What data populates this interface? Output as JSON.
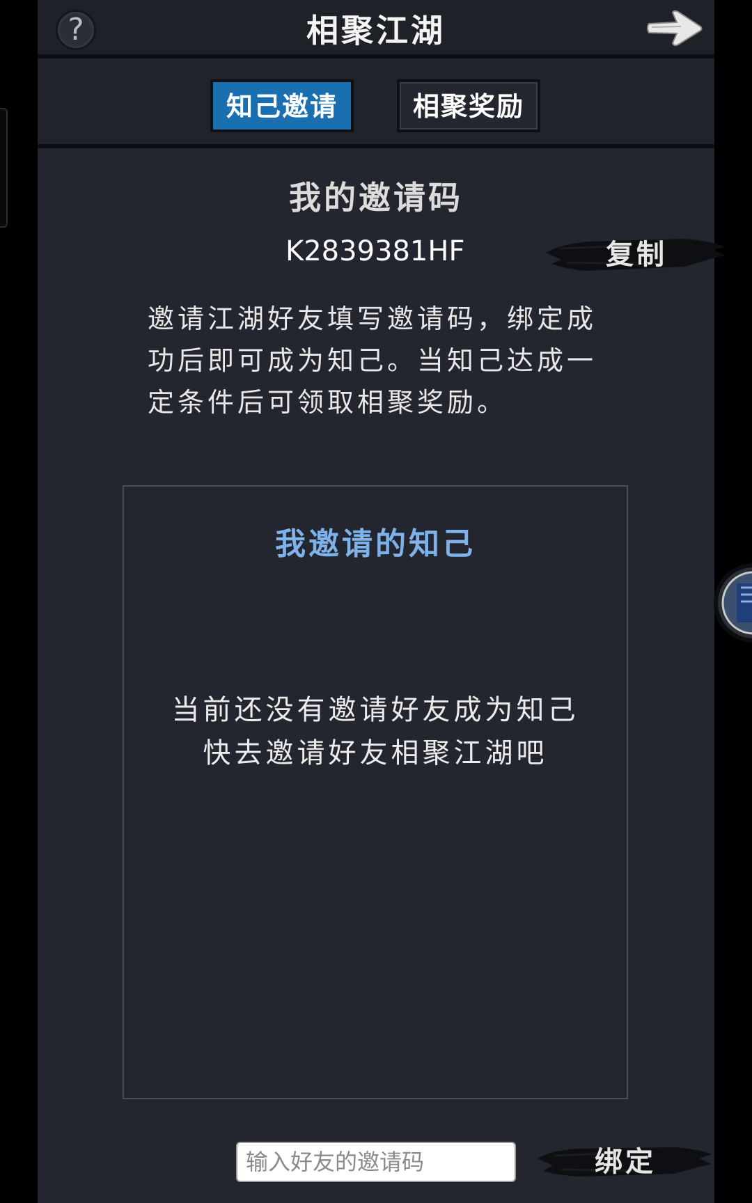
{
  "header": {
    "title": "相聚江湖",
    "help_label": "?"
  },
  "tabs": [
    {
      "label": "知己邀请",
      "active": true
    },
    {
      "label": "相聚奖励",
      "active": false
    }
  ],
  "invite": {
    "heading": "我的邀请码",
    "code": "K2839381HF",
    "copy_label": "复制",
    "description": "邀请江湖好友填写邀请码，绑定成功后即可成为知己。当知己达成一定条件后可领取相聚奖励。"
  },
  "friends": {
    "title": "我邀请的知己",
    "empty_line1": "当前还没有邀请好友成为知己",
    "empty_line2": "快去邀请好友相聚江湖吧"
  },
  "bind": {
    "placeholder": "输入好友的邀请码",
    "button_label": "绑定"
  },
  "colors": {
    "panel_bg": "#23262f",
    "active_tab": "#1a6fb1",
    "friends_title": "#7fb2ea"
  }
}
